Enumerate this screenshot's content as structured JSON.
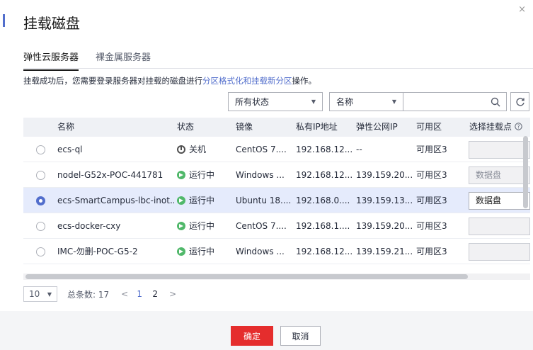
{
  "dialog": {
    "title": "挂载磁盘",
    "close_glyph": "×"
  },
  "tabs": [
    {
      "label": "弹性云服务器",
      "active": true
    },
    {
      "label": "裸金属服务器",
      "active": false
    }
  ],
  "hint": {
    "prefix": "挂载成功后，您需要登录服务器对挂载的磁盘进行",
    "link1": "分区格式化和挂载新分区",
    "suffix": "操作。"
  },
  "filters": {
    "status_select": "所有状态",
    "field_select": "名称",
    "search_value": ""
  },
  "table": {
    "columns": [
      "名称",
      "状态",
      "镜像",
      "私有IP地址",
      "弹性公网IP",
      "可用区",
      "选择挂载点"
    ],
    "rows": [
      {
        "name": "ecs-ql",
        "status": "关机",
        "status_type": "off",
        "image": "CentOS 7....",
        "private_ip": "192.168.12...",
        "eip": "--",
        "az": "可用区3",
        "mount": "",
        "selected": false
      },
      {
        "name": "nodel-G52x-POC-441781",
        "status": "运行中",
        "status_type": "running",
        "image": "Windows ...",
        "private_ip": "192.168.12...",
        "eip": "139.159.20...",
        "az": "可用区3",
        "mount": "数据盘",
        "selected": false
      },
      {
        "name": "ecs-SmartCampus-lbc-inot...",
        "status": "运行中",
        "status_type": "running",
        "image": "Ubuntu 18....",
        "private_ip": "192.168.0....",
        "eip": "139.159.13...",
        "az": "可用区3",
        "mount": "数据盘",
        "selected": true
      },
      {
        "name": "ecs-docker-cxy",
        "status": "运行中",
        "status_type": "running",
        "image": "CentOS 7....",
        "private_ip": "192.168.1....",
        "eip": "139.159.20...",
        "az": "可用区3",
        "mount": "",
        "selected": false
      },
      {
        "name": "IMC-勿删-POC-G5-2",
        "status": "运行中",
        "status_type": "running",
        "image": "Windows ...",
        "private_ip": "192.168.12...",
        "eip": "139.159.21...",
        "az": "可用区3",
        "mount": "",
        "selected": false
      }
    ]
  },
  "pager": {
    "page_size": "10",
    "total": "总条数: 17",
    "pages": [
      "1",
      "2"
    ],
    "current_page": "1"
  },
  "footer": {
    "ok_label": "确定",
    "cancel_label": "取消"
  },
  "colors": {
    "accent": "#526ecc",
    "primary_button": "#e52d2d",
    "running": "#50b86a",
    "selected_row": "#e5ebfc"
  }
}
